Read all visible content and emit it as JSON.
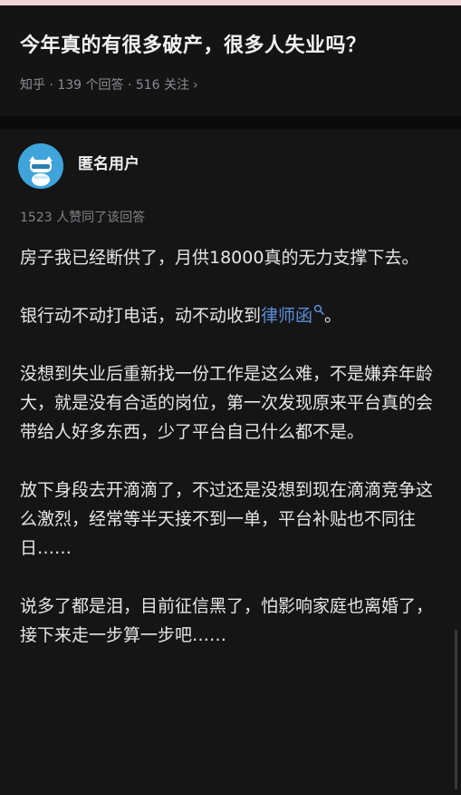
{
  "question": {
    "title": "今年真的有很多破产，很多人失业吗？",
    "meta": "知乎 · 139 个回答 · 516 关注",
    "chevron": "›"
  },
  "answer": {
    "author": "匿名用户",
    "votes": "1523 人赞同了该回答",
    "paragraphs": {
      "p1": "房子我已经断供了，月供18000真的无力支撑下去。",
      "p2_before": "银行动不动打电话，动不动收到",
      "p2_link": "律师函",
      "p2_after": "。",
      "p3": "没想到失业后重新找一份工作是这么难，不是嫌弃年龄大，就是没有合适的岗位，第一次发现原来平台真的会带给人好多东西，少了平台自己什么都不是。",
      "p4": "放下身段去开滴滴了，不过还是没想到现在滴滴竞争这么激烈，经常等半天接不到一单，平台补贴也不同往日……",
      "p5": "说多了都是泪，目前征信黑了，怕影响家庭也离婚了，接下来走一步算一步吧……"
    }
  },
  "icons": {
    "avatar": "anonymous-avatar-icon",
    "search": "search-icon",
    "chevron": "chevron-right-icon"
  },
  "colors": {
    "background": "#121213",
    "text": "#e6e6e7",
    "meta": "#8d8d92",
    "link": "#5a8fd9",
    "avatar": "#3ea4da",
    "top_accent": "#f1d5d6"
  }
}
